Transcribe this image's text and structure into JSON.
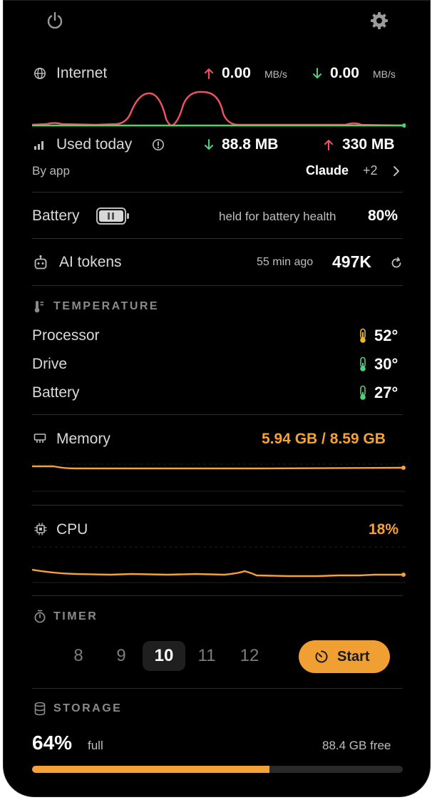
{
  "colors": {
    "accent": "#f5a13a",
    "upload": "#ef5360",
    "download": "#4ed17a",
    "warm_temp": "#e8b826",
    "cool_temp": "#4ed17a"
  },
  "header": {
    "power_icon": "power-icon",
    "settings_icon": "gear-icon"
  },
  "internet": {
    "label": "Internet",
    "upload_value": "0.00",
    "download_value": "0.00",
    "unit": "MB/s"
  },
  "usage": {
    "label": "Used today",
    "download": "88.8 MB",
    "upload": "330 MB",
    "by_app_label": "By app",
    "top_app": "Claude",
    "more_count": "+2"
  },
  "battery": {
    "label": "Battery",
    "status": "held for battery health",
    "percent": "80%",
    "toggle_state": "paused"
  },
  "ai_tokens": {
    "label": "AI tokens",
    "time_ago": "55 min ago",
    "value": "497K"
  },
  "temperature": {
    "heading": "TEMPERATURE",
    "rows": [
      {
        "label": "Processor",
        "value": "52°",
        "level": "warm"
      },
      {
        "label": "Drive",
        "value": "30°",
        "level": "cool"
      },
      {
        "label": "Battery",
        "value": "27°",
        "level": "cool"
      }
    ]
  },
  "memory": {
    "label": "Memory",
    "value": "5.94 GB / 8.59 GB"
  },
  "cpu": {
    "label": "CPU",
    "value": "18%"
  },
  "timer": {
    "heading": "TIMER",
    "options": [
      "8",
      "9",
      "10",
      "11",
      "12"
    ],
    "selected": "10",
    "start_label": "Start"
  },
  "storage": {
    "heading": "STORAGE",
    "percent": "64%",
    "full_label": "full",
    "free": "88.4 GB free",
    "fill_fraction": 0.64
  }
}
